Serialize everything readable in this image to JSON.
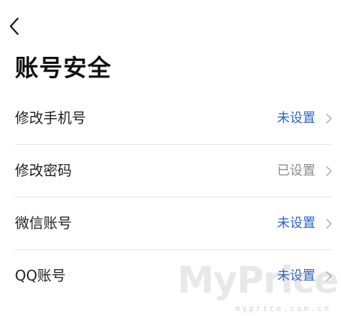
{
  "header": {
    "back_icon": "chevron-left-icon",
    "title": "账号安全"
  },
  "colors": {
    "unset": "#2b63c8",
    "set": "#8a8a8a",
    "divider": "#e6e6e6"
  },
  "rows": [
    {
      "label": "修改手机号",
      "status": "未设置",
      "status_type": "unset"
    },
    {
      "label": "修改密码",
      "status": "已设置",
      "status_type": "set"
    },
    {
      "label": "微信账号",
      "status": "未设置",
      "status_type": "unset"
    },
    {
      "label": "QQ账号",
      "status": "未设置",
      "status_type": "unset"
    }
  ],
  "watermark": {
    "logo": "MyPrice",
    "site": "myprice.com.cn"
  }
}
